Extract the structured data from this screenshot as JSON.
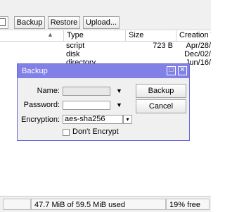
{
  "toolbar": {
    "backup_label": "Backup",
    "restore_label": "Restore",
    "upload_label": "Upload..."
  },
  "table": {
    "columns": [
      "Type",
      "Size",
      "Creation Ti"
    ],
    "rows": [
      {
        "type": "script",
        "size": "723 B",
        "creation": "Apr/28/"
      },
      {
        "type": "disk",
        "size": "",
        "creation": "Dec/02/"
      },
      {
        "type": "directory",
        "size": "",
        "creation": "Jun/16/"
      }
    ]
  },
  "dialog": {
    "title": "Backup",
    "name_label": "Name:",
    "name_value": "",
    "password_label": "Password:",
    "password_value": "",
    "encryption_label": "Encryption:",
    "encryption_value": "aes-sha256",
    "dont_encrypt_label": "Don't Encrypt",
    "dont_encrypt_checked": false,
    "backup_button": "Backup",
    "cancel_button": "Cancel"
  },
  "status": {
    "usage": "47.7 MiB of 59.5 MiB used",
    "free": "19% free"
  },
  "colors": {
    "dialog_title_bg": "#8080e6"
  }
}
